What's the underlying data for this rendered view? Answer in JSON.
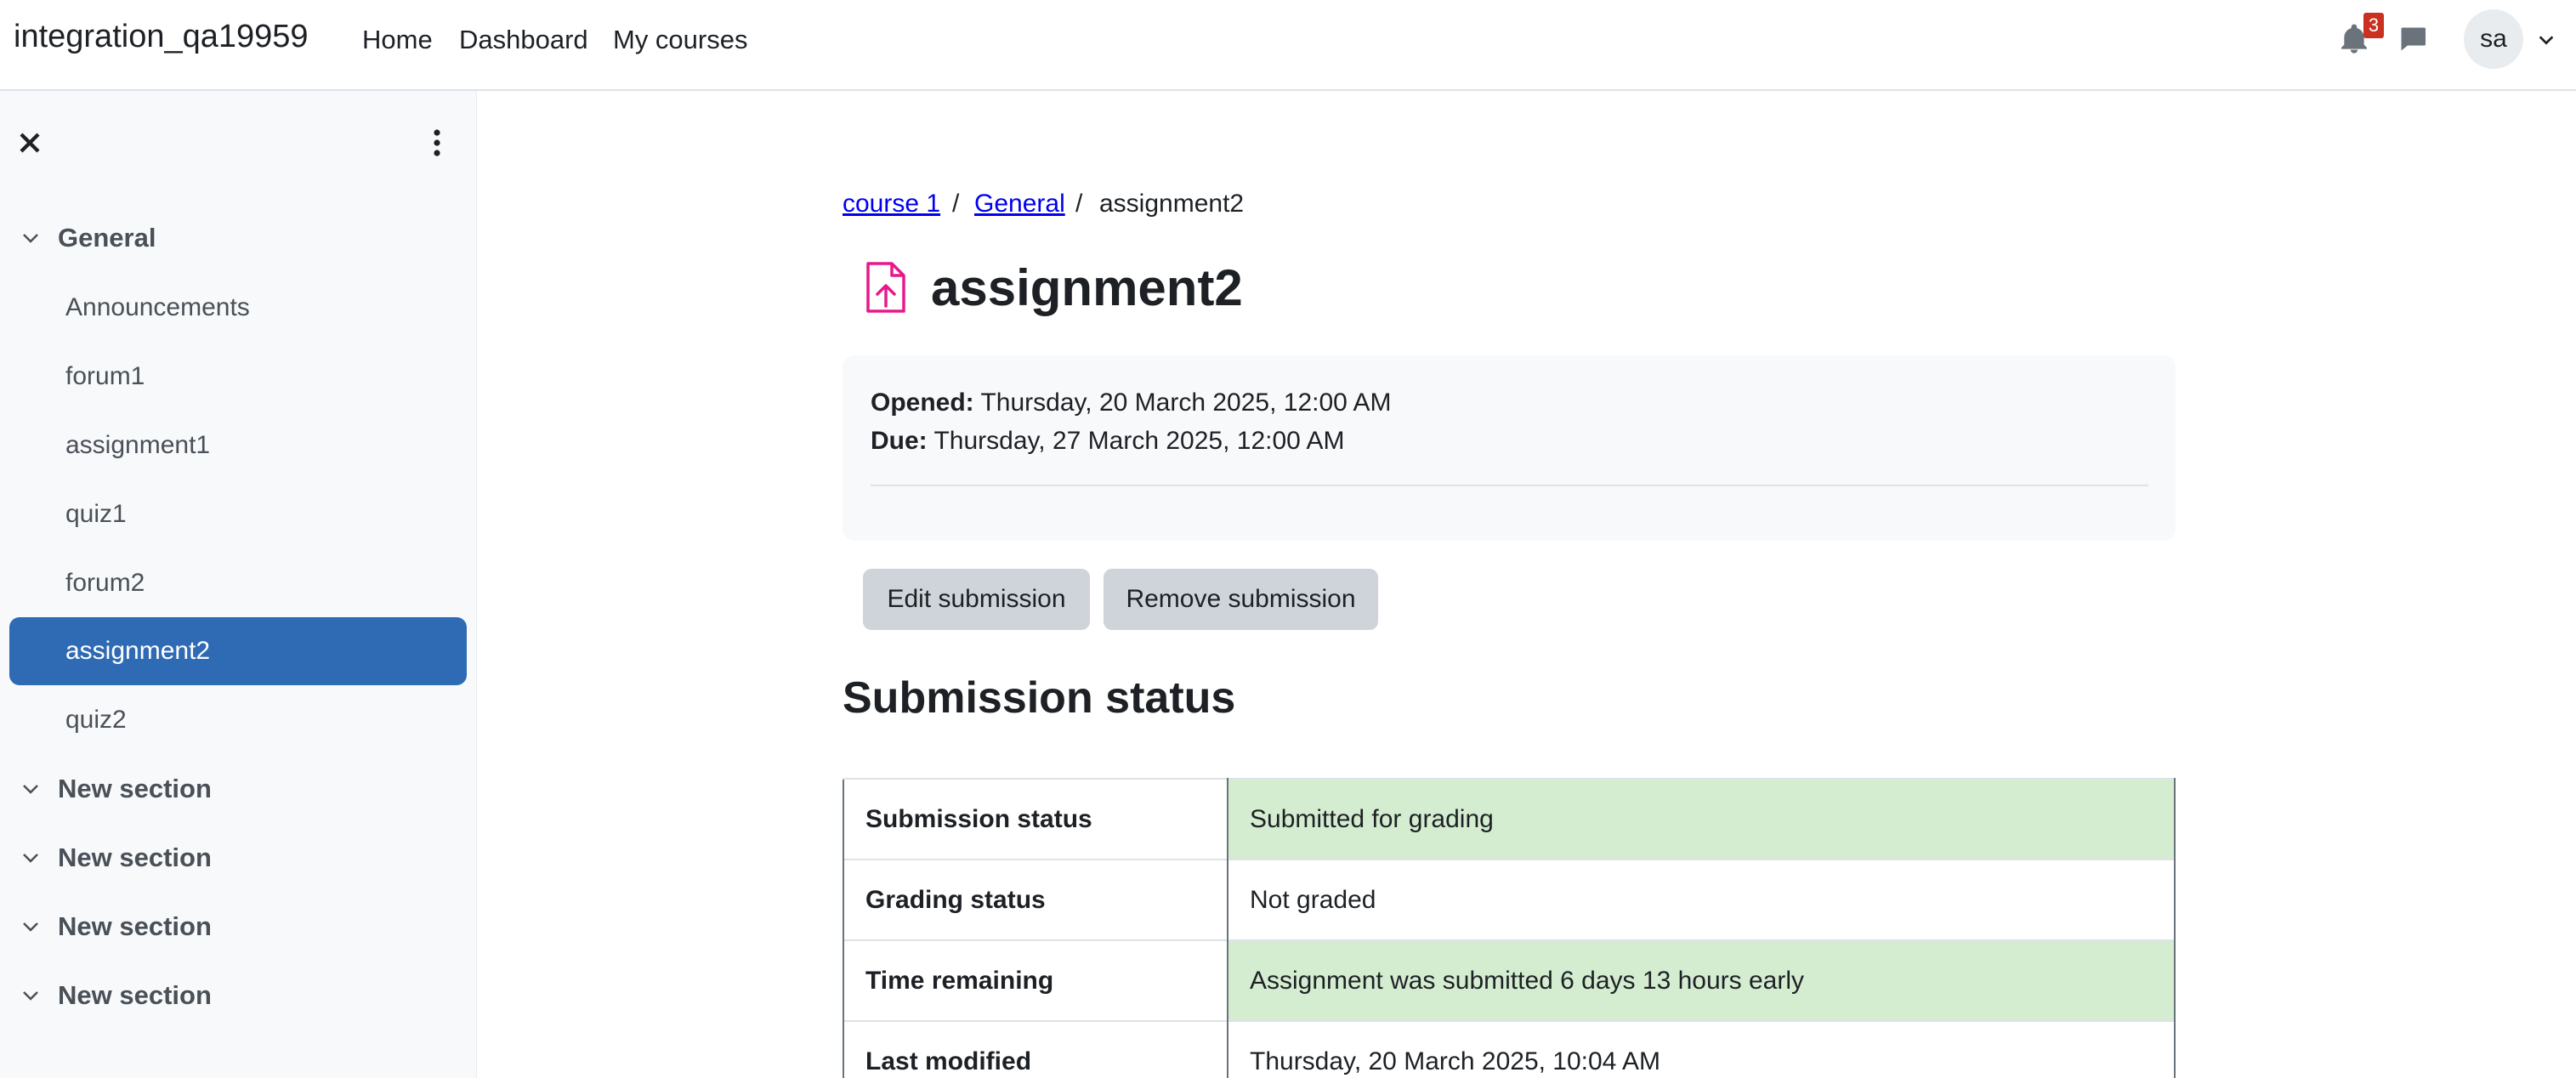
{
  "navbar": {
    "site_name": "integration_qa19959",
    "links": [
      "Home",
      "Dashboard",
      "My courses"
    ],
    "notification_count": "3",
    "user_initials": "sa"
  },
  "drawer": {
    "sections": [
      {
        "title": "General",
        "items": [
          "Announcements",
          "forum1",
          "assignment1",
          "quiz1",
          "forum2",
          "assignment2",
          "quiz2"
        ],
        "active_item": "assignment2"
      },
      {
        "title": "New section"
      },
      {
        "title": "New section"
      },
      {
        "title": "New section"
      },
      {
        "title": "New section"
      }
    ]
  },
  "breadcrumb": {
    "items": [
      "course 1",
      "General",
      "assignment2"
    ],
    "separator": "/"
  },
  "page": {
    "title": "assignment2",
    "opened_label": "Opened:",
    "opened_value": "Thursday, 20 March 2025, 12:00 AM",
    "due_label": "Due:",
    "due_value": "Thursday, 27 March 2025, 12:00 AM",
    "edit_button": "Edit submission",
    "remove_button": "Remove submission",
    "submission_heading": "Submission status"
  },
  "submission_table": [
    {
      "label": "Submission status",
      "value": "Submitted for grading",
      "highlight": true
    },
    {
      "label": "Grading status",
      "value": "Not graded",
      "highlight": false
    },
    {
      "label": "Time remaining",
      "value": "Assignment was submitted 6 days 13 hours early",
      "highlight": true
    },
    {
      "label": "Last modified",
      "value": "Thursday, 20 March 2025, 10:04 AM",
      "highlight": false
    }
  ],
  "colors": {
    "accent": "#0f6cbf",
    "active_item_bg": "#2f6ab4",
    "success_row": "#d4edd0",
    "badge": "#ca3120",
    "assignment_icon": "#e8188b"
  },
  "icons": [
    "close-icon",
    "kebab-menu-icon",
    "chevron-down-icon",
    "bell-icon",
    "chat-icon",
    "assignment-upload-icon"
  ]
}
